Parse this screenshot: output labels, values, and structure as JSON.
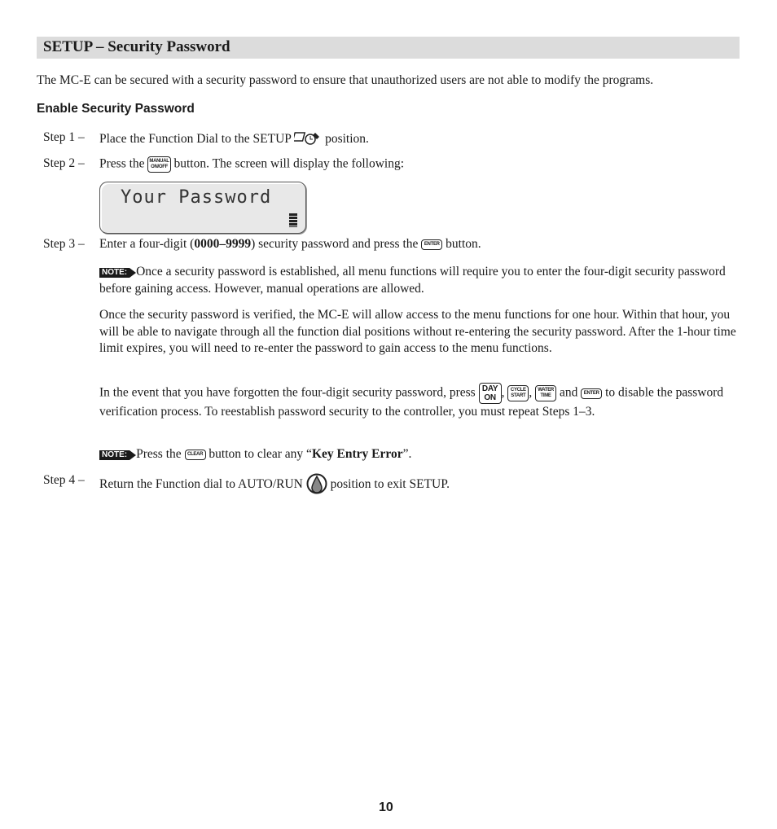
{
  "header": {
    "title": "SETUP – Security Password"
  },
  "intro": "The MC-E can be secured with a security password to ensure that unauthorized users are not able to modify the programs.",
  "subheading": "Enable Security Password",
  "steps": [
    {
      "label": "Step 1 –",
      "pre": "Place the Function Dial to the SETUP",
      "post": "position."
    },
    {
      "label": "Step 2 –",
      "pre": "Press the",
      "post": "button. The screen will display the following:"
    },
    {
      "label": "Step 3 –",
      "pre": "Enter a four-digit (",
      "bold": "0000–9999",
      "post": ") security password and press the",
      "post2": "button."
    },
    {
      "label": "Step 4 –",
      "pre": "Return the Function dial to AUTO/RUN",
      "post": "position to exit SETUP."
    }
  ],
  "keys": {
    "manual": [
      "MANUAL",
      "ON/OFF"
    ],
    "enter": "ENTER",
    "day_on": [
      "DAY",
      "ON"
    ],
    "cycle_start": [
      "CYCLE",
      "START"
    ],
    "water_time": [
      "WATER",
      "TIME"
    ],
    "clear": "CLEAR"
  },
  "lcd": {
    "text": "Your Password"
  },
  "note_label": "NOTE:",
  "note1": "Once a security password is established, all menu functions will require you to enter the four-digit security password before gaining access. However, manual operations are allowed.",
  "para1": "Once the security password is verified, the MC-E will allow access to the menu functions for one hour. Within that hour, you will be able to navigate through all the function dial positions without re-entering the security password. After the 1-hour time limit expires, you will need to re-enter the password to gain access to the menu functions.",
  "para2": {
    "pre": "In the event that you have forgotten the four-digit security password, press",
    "sep1": ",",
    "sep2": ",",
    "and": "and",
    "post": "to disable the password verification process. To reestablish password security to the controller, you must repeat Steps 1–3."
  },
  "note2": {
    "pre": "Press the",
    "mid": "button to clear any “",
    "bold": "Key Entry Error",
    "post": "”."
  },
  "page_number": "10"
}
